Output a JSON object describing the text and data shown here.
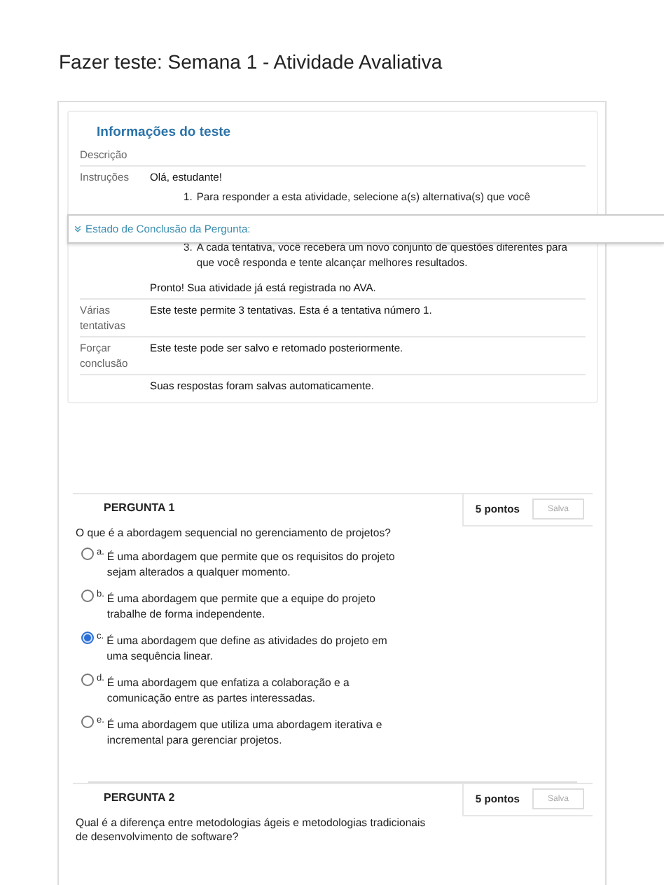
{
  "page_title": "Fazer teste: Semana 1 - Atividade Avaliativa",
  "info_panel": {
    "title": "Informações do teste",
    "rows": [
      {
        "kind": "plain",
        "label": "Descrição"
      },
      {
        "kind": "instructions",
        "label": "Instruções",
        "greeting": "Olá, estudante!",
        "steps": [
          {
            "number": "1.",
            "text": "Para responder a esta atividade, selecione a(s) alternativa(s) que você"
          },
          {
            "number": "3.",
            "text": "A cada tentativa, você receberá um novo conjunto de questões diferentes para que você responda e tente alcançar melhores resultados."
          }
        ],
        "closing": "Pronto! Sua atividade já está registrada no AVA."
      },
      {
        "kind": "plain",
        "label": "Várias tentativas",
        "value": "Este teste permite 3 tentativas. Esta é a tentativa número 1."
      },
      {
        "kind": "plain",
        "label": "Forçar conclusão",
        "value": "Este teste pode ser salvo e retomado posteriormente."
      },
      {
        "kind": "plain",
        "value": "Suas respostas foram salvas automaticamente."
      }
    ]
  },
  "completion_bar": {
    "label": "Estado de Conclusão da Pergunta:"
  },
  "questions": [
    {
      "number": "PERGUNTA 1",
      "points": "5 pontos",
      "status": "Salva",
      "text": "O que é a abordagem sequencial no gerenciamento de projetos?",
      "options": [
        {
          "letter": "a.",
          "text": "É uma abordagem que permite que os requisitos do projeto sejam alterados a qualquer momento.",
          "selected": false
        },
        {
          "letter": "b.",
          "text": "É uma abordagem que permite que a equipe do projeto trabalhe de forma independente.",
          "selected": false
        },
        {
          "letter": "c.",
          "text": "É uma abordagem que define as atividades do projeto em uma sequência linear.",
          "selected": true
        },
        {
          "letter": "d.",
          "text": "É uma abordagem que enfatiza a colaboração e a comunicação entre as partes interessadas.",
          "selected": false
        },
        {
          "letter": "e.",
          "text": "É uma abordagem que utiliza uma abordagem iterativa e incremental para gerenciar projetos.",
          "selected": false
        }
      ]
    },
    {
      "number": "PERGUNTA 2",
      "points": "5 pontos",
      "status": "Salva",
      "text": "Qual é a diferença entre metodologias ágeis e metodologias tradicionais de desenvolvimento de software?"
    }
  ]
}
